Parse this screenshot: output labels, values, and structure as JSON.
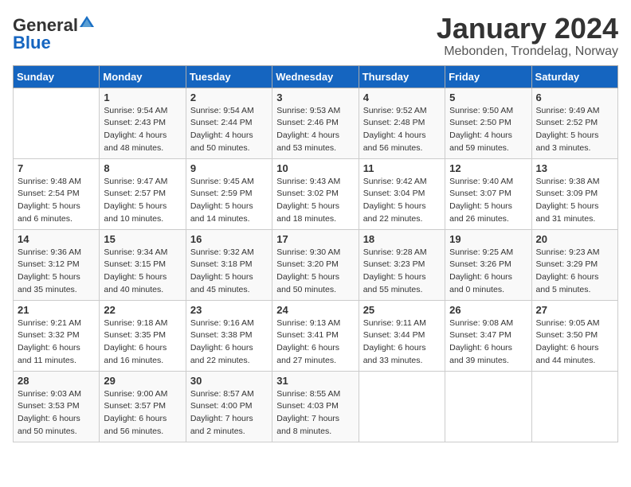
{
  "logo": {
    "general": "General",
    "blue": "Blue"
  },
  "title": "January 2024",
  "subtitle": "Mebonden, Trondelag, Norway",
  "days_header": [
    "Sunday",
    "Monday",
    "Tuesday",
    "Wednesday",
    "Thursday",
    "Friday",
    "Saturday"
  ],
  "weeks": [
    [
      {
        "day": "",
        "info": ""
      },
      {
        "day": "1",
        "info": "Sunrise: 9:54 AM\nSunset: 2:43 PM\nDaylight: 4 hours\nand 48 minutes."
      },
      {
        "day": "2",
        "info": "Sunrise: 9:54 AM\nSunset: 2:44 PM\nDaylight: 4 hours\nand 50 minutes."
      },
      {
        "day": "3",
        "info": "Sunrise: 9:53 AM\nSunset: 2:46 PM\nDaylight: 4 hours\nand 53 minutes."
      },
      {
        "day": "4",
        "info": "Sunrise: 9:52 AM\nSunset: 2:48 PM\nDaylight: 4 hours\nand 56 minutes."
      },
      {
        "day": "5",
        "info": "Sunrise: 9:50 AM\nSunset: 2:50 PM\nDaylight: 4 hours\nand 59 minutes."
      },
      {
        "day": "6",
        "info": "Sunrise: 9:49 AM\nSunset: 2:52 PM\nDaylight: 5 hours\nand 3 minutes."
      }
    ],
    [
      {
        "day": "7",
        "info": "Sunrise: 9:48 AM\nSunset: 2:54 PM\nDaylight: 5 hours\nand 6 minutes."
      },
      {
        "day": "8",
        "info": "Sunrise: 9:47 AM\nSunset: 2:57 PM\nDaylight: 5 hours\nand 10 minutes."
      },
      {
        "day": "9",
        "info": "Sunrise: 9:45 AM\nSunset: 2:59 PM\nDaylight: 5 hours\nand 14 minutes."
      },
      {
        "day": "10",
        "info": "Sunrise: 9:43 AM\nSunset: 3:02 PM\nDaylight: 5 hours\nand 18 minutes."
      },
      {
        "day": "11",
        "info": "Sunrise: 9:42 AM\nSunset: 3:04 PM\nDaylight: 5 hours\nand 22 minutes."
      },
      {
        "day": "12",
        "info": "Sunrise: 9:40 AM\nSunset: 3:07 PM\nDaylight: 5 hours\nand 26 minutes."
      },
      {
        "day": "13",
        "info": "Sunrise: 9:38 AM\nSunset: 3:09 PM\nDaylight: 5 hours\nand 31 minutes."
      }
    ],
    [
      {
        "day": "14",
        "info": "Sunrise: 9:36 AM\nSunset: 3:12 PM\nDaylight: 5 hours\nand 35 minutes."
      },
      {
        "day": "15",
        "info": "Sunrise: 9:34 AM\nSunset: 3:15 PM\nDaylight: 5 hours\nand 40 minutes."
      },
      {
        "day": "16",
        "info": "Sunrise: 9:32 AM\nSunset: 3:18 PM\nDaylight: 5 hours\nand 45 minutes."
      },
      {
        "day": "17",
        "info": "Sunrise: 9:30 AM\nSunset: 3:20 PM\nDaylight: 5 hours\nand 50 minutes."
      },
      {
        "day": "18",
        "info": "Sunrise: 9:28 AM\nSunset: 3:23 PM\nDaylight: 5 hours\nand 55 minutes."
      },
      {
        "day": "19",
        "info": "Sunrise: 9:25 AM\nSunset: 3:26 PM\nDaylight: 6 hours\nand 0 minutes."
      },
      {
        "day": "20",
        "info": "Sunrise: 9:23 AM\nSunset: 3:29 PM\nDaylight: 6 hours\nand 5 minutes."
      }
    ],
    [
      {
        "day": "21",
        "info": "Sunrise: 9:21 AM\nSunset: 3:32 PM\nDaylight: 6 hours\nand 11 minutes."
      },
      {
        "day": "22",
        "info": "Sunrise: 9:18 AM\nSunset: 3:35 PM\nDaylight: 6 hours\nand 16 minutes."
      },
      {
        "day": "23",
        "info": "Sunrise: 9:16 AM\nSunset: 3:38 PM\nDaylight: 6 hours\nand 22 minutes."
      },
      {
        "day": "24",
        "info": "Sunrise: 9:13 AM\nSunset: 3:41 PM\nDaylight: 6 hours\nand 27 minutes."
      },
      {
        "day": "25",
        "info": "Sunrise: 9:11 AM\nSunset: 3:44 PM\nDaylight: 6 hours\nand 33 minutes."
      },
      {
        "day": "26",
        "info": "Sunrise: 9:08 AM\nSunset: 3:47 PM\nDaylight: 6 hours\nand 39 minutes."
      },
      {
        "day": "27",
        "info": "Sunrise: 9:05 AM\nSunset: 3:50 PM\nDaylight: 6 hours\nand 44 minutes."
      }
    ],
    [
      {
        "day": "28",
        "info": "Sunrise: 9:03 AM\nSunset: 3:53 PM\nDaylight: 6 hours\nand 50 minutes."
      },
      {
        "day": "29",
        "info": "Sunrise: 9:00 AM\nSunset: 3:57 PM\nDaylight: 6 hours\nand 56 minutes."
      },
      {
        "day": "30",
        "info": "Sunrise: 8:57 AM\nSunset: 4:00 PM\nDaylight: 7 hours\nand 2 minutes."
      },
      {
        "day": "31",
        "info": "Sunrise: 8:55 AM\nSunset: 4:03 PM\nDaylight: 7 hours\nand 8 minutes."
      },
      {
        "day": "",
        "info": ""
      },
      {
        "day": "",
        "info": ""
      },
      {
        "day": "",
        "info": ""
      }
    ]
  ]
}
